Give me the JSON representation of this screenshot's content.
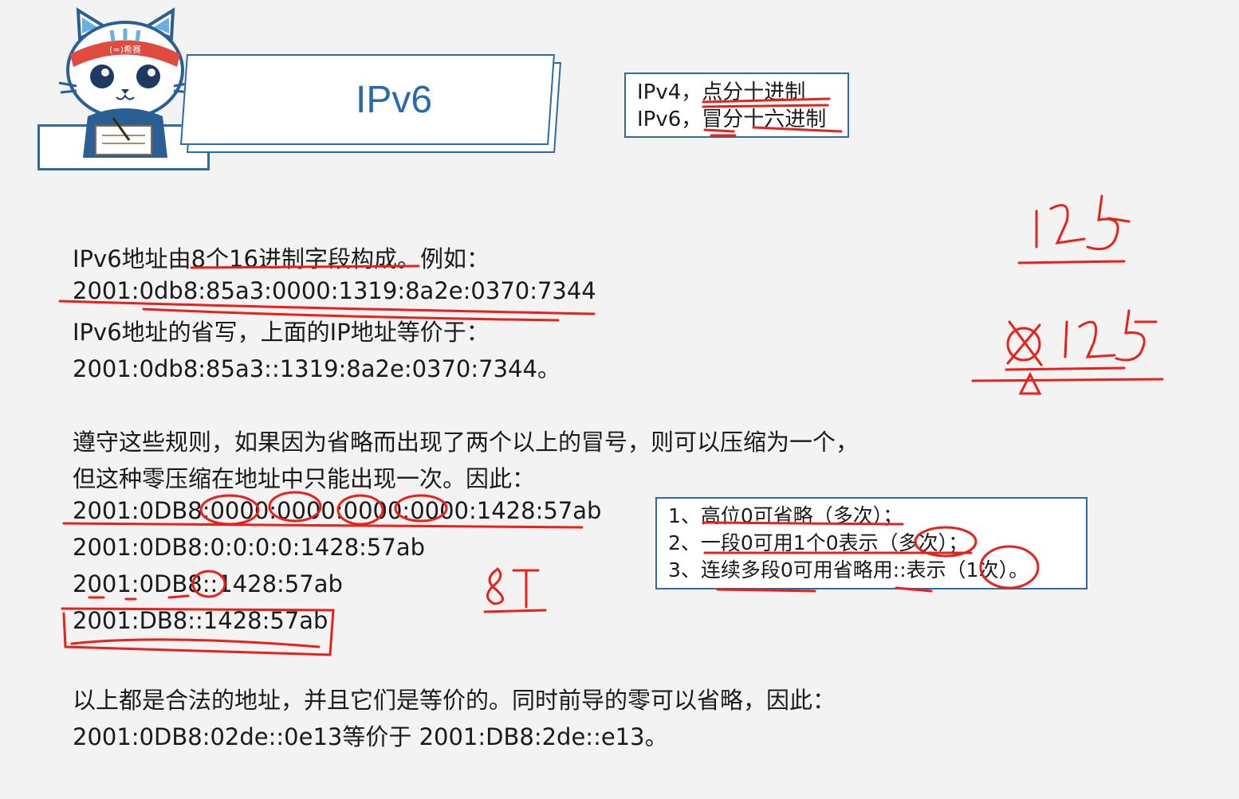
{
  "header": {
    "title": "IPv6",
    "badge": "(=)希赛"
  },
  "notation": [
    "IPv4，点分十进制",
    "IPv6，冒分十六进制"
  ],
  "body": {
    "lines": [
      "IPv6地址由8个16进制字段构成。例如：",
      "2001:0db8:85a3:0000:1319:8a2e:0370:7344",
      "IPv6地址的省写，上面的IP地址等价于：",
      "2001:0db8:85a3::1319:8a2e:0370:7344。",
      "遵守这些规则，如果因为省略而出现了两个以上的冒号，则可以压缩为一个，",
      "但这种零压缩在地址中只能出现一次。因此：",
      "2001:0DB8:0000:0000:0000:0000:1428:57ab",
      "2001:0DB8:0:0:0:0:1428:57ab",
      "2001:0DB8::1428:57ab",
      "2001:DB8::1428:57ab",
      "以上都是合法的地址，并且它们是等价的。同时前导的零可以省略，因此：",
      "2001:0DB8:02de::0e13等价于 2001:DB8:2de::e13。"
    ]
  },
  "rules": [
    "1、高位0可省略（多次）；",
    "2、一段0可用1个0表示（多次）；",
    "3、连续多段0可用省略用::表示（1次）。"
  ],
  "handwriting": {
    "top_right": "125",
    "middle_right": "125",
    "note": "8T"
  }
}
